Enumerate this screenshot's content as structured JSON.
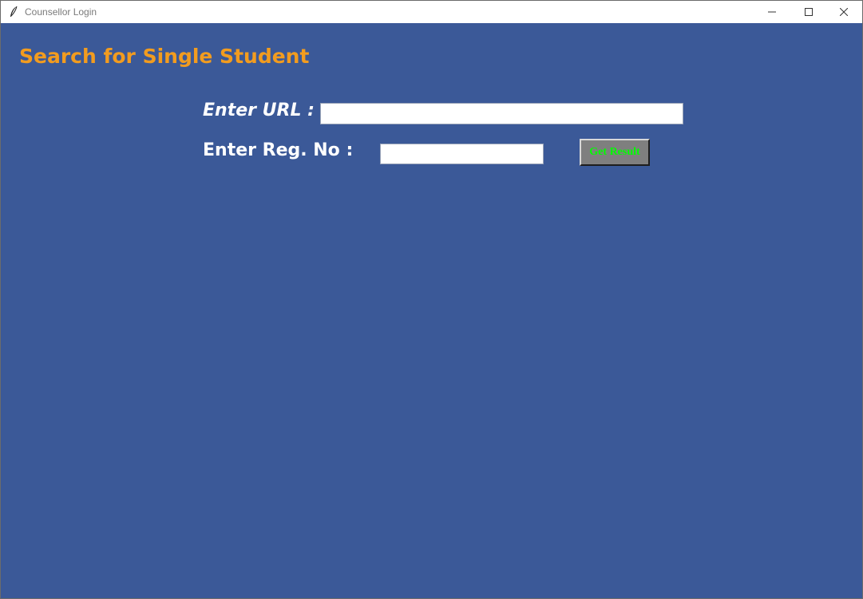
{
  "window": {
    "title": "Counsellor Login",
    "icon": "feather-icon",
    "controls": [
      "minimize-icon",
      "maximize-icon",
      "close-icon"
    ]
  },
  "main": {
    "heading": "Search for Single Student",
    "url_label": "Enter URL :",
    "url_value": "",
    "reg_label": "Enter Reg. No :",
    "reg_value": "",
    "submit_label": "Get Result"
  },
  "colors": {
    "background": "#3b5998",
    "heading": "#f29c1f",
    "label": "#ffffff",
    "button_bg": "#7f7f7f",
    "button_text": "#00ff00"
  }
}
